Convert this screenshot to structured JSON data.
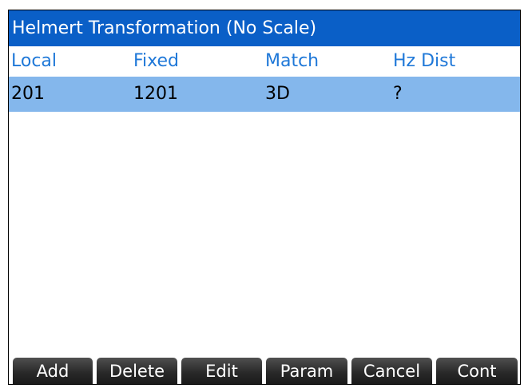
{
  "title": "Helmert Transformation (No Scale)",
  "columns": [
    "Local",
    "Fixed",
    "Match",
    "Hz Dist"
  ],
  "rows": [
    {
      "local": "201",
      "fixed": "1201",
      "match": "3D",
      "hz_dist": "?"
    }
  ],
  "softkeys": [
    "Add",
    "Delete",
    "Edit",
    "Param",
    "Cancel",
    "Cont"
  ],
  "colors": {
    "title_bg": "#0a5fc7",
    "header_text": "#1f78d8",
    "selected_row": "#84b7ec",
    "softkey_bg": "#2a2a2a"
  }
}
